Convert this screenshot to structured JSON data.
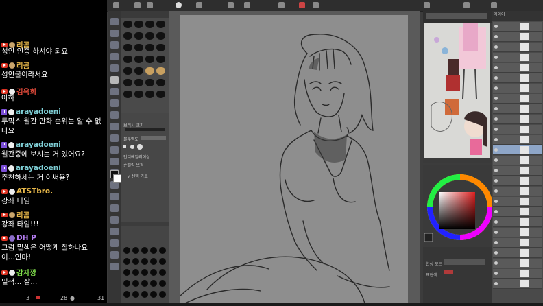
{
  "chat": {
    "messages": [
      {
        "user": "리곰",
        "user_color": "#e8b84a",
        "text": "성인 인증 하셔야 되요",
        "platform": "youtube",
        "avatar": "tan"
      },
      {
        "user": "리곰",
        "user_color": "#e8b84a",
        "text": "성인물이라서요",
        "platform": "youtube",
        "avatar": "tan"
      },
      {
        "user": "김옥희",
        "user_color": "#e04a3a",
        "text": "아하",
        "platform": "youtube",
        "avatar": "white"
      },
      {
        "user": "arayadoeni",
        "user_color": "#7fcfd6",
        "text": "투믹스 월간 만화 순위는 알 수 없\n나요",
        "platform": "twitch",
        "avatar": "white"
      },
      {
        "user": "arayadoeni",
        "user_color": "#7fcfd6",
        "text": "월간중에 보시는 거 있어요?",
        "platform": "twitch",
        "avatar": "white"
      },
      {
        "user": "arayadoeni",
        "user_color": "#7fcfd6",
        "text": "추천하세는 거 이써용?",
        "platform": "twitch",
        "avatar": "white"
      },
      {
        "user": "ATSTbro.",
        "user_color": "#e8b84a",
        "text": "강좌 타임",
        "platform": "youtube",
        "avatar": "white"
      },
      {
        "user": "리곰",
        "user_color": "#e8b84a",
        "text": "강좌 타임!!!",
        "platform": "youtube",
        "avatar": "tan"
      },
      {
        "user": "DH P",
        "user_color": "#b37cf0",
        "text": "그럼 밑색은 어떻게 칠하나요\n이...인마!",
        "platform": "youtube",
        "avatar": "purple"
      },
      {
        "user": "감자깡",
        "user_color": "#7fdc4a",
        "text": "밑색... 잘...",
        "platform": "youtube",
        "avatar": "white"
      }
    ],
    "footer": {
      "viewers_a": "3",
      "viewers_b": "28",
      "viewers_c": "31"
    }
  },
  "app": {
    "toolprop": {
      "label_a": "브러시 크기",
      "label_b": "불투명도",
      "label_c": "안티에일리어싱",
      "label_d": "손떨림 보정",
      "check_label": "√ 선택 가로"
    },
    "layer_panel_title": "레이어",
    "bottom": {
      "label_a": "합성 모드",
      "label_b": "표현색"
    },
    "accent_color": "#8ea6c8"
  }
}
